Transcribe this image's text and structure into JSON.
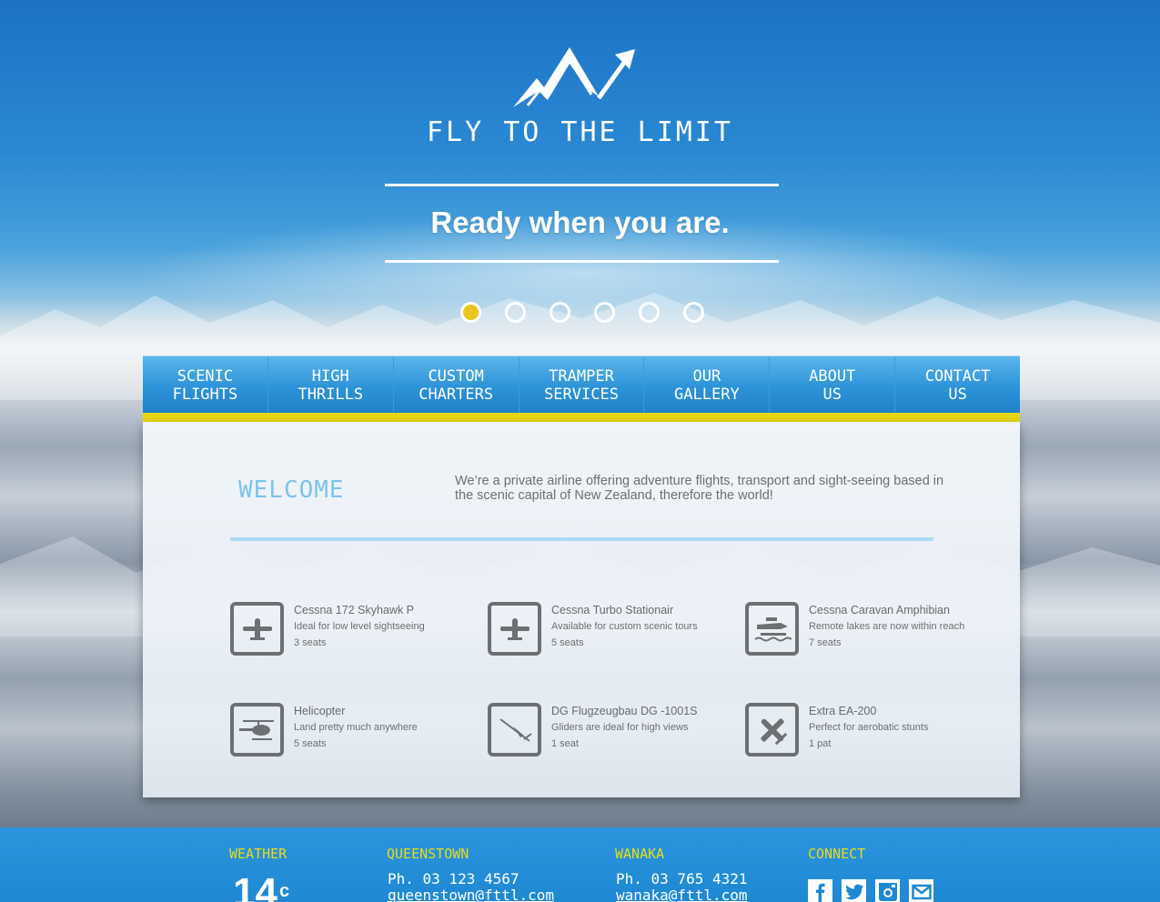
{
  "brand": {
    "name": "FLY TO THE LIMIT",
    "tagline": "Ready when you are."
  },
  "slider": {
    "slide_count": 6,
    "active_index": 0,
    "active_color": "#e9c51e"
  },
  "nav": [
    {
      "line1": "SCENIC",
      "line2": "FLIGHTS"
    },
    {
      "line1": "HIGH",
      "line2": "THRILLS"
    },
    {
      "line1": "CUSTOM",
      "line2": "CHARTERS"
    },
    {
      "line1": "TRAMPER",
      "line2": "SERVICES"
    },
    {
      "line1": "OUR",
      "line2": "GALLERY"
    },
    {
      "line1": "ABOUT",
      "line2": "US"
    },
    {
      "line1": "CONTACT",
      "line2": "US"
    }
  ],
  "welcome": {
    "title": "WELCOME",
    "text": "We’re a private airline offering adventure flights, transport and sight-seeing based in the scenic capital of New Zealand, therefore the world!"
  },
  "fleet": [
    {
      "name": "Cessna 172 Skyhawk P",
      "desc": "Ideal for low level sightseeing",
      "seats": "3 seats",
      "icon": "plane-icon"
    },
    {
      "name": "Cessna Turbo Stationair",
      "desc": "Available for custom scenic tours",
      "seats": "5 seats",
      "icon": "plane-icon"
    },
    {
      "name": "Cessna Caravan Amphibian",
      "desc": "Remote lakes are now within reach",
      "seats": "7 seats",
      "icon": "seaplane-icon"
    },
    {
      "name": "Helicopter",
      "desc": "Land pretty much anywhere",
      "seats": "5 seats",
      "icon": "helicopter-icon"
    },
    {
      "name": "DG Flugzeugbau DG -1001S",
      "desc": "Gliders are ideal for high views",
      "seats": "1 seat",
      "icon": "glider-icon"
    },
    {
      "name": "Extra EA-200",
      "desc": "Perfect for aerobatic stunts",
      "seats": "1 pat",
      "icon": "aerobatic-plane-icon"
    }
  ],
  "footer": {
    "weather": {
      "heading": "WEATHER",
      "temp": "14",
      "unit": "c"
    },
    "queenstown": {
      "heading": "QUEENSTOWN",
      "phone": "Ph. 03 123 4567",
      "email": "queenstown@fttl.com"
    },
    "wanaka": {
      "heading": "WANAKA",
      "phone": "Ph. 03 765 4321",
      "email": "wanaka@fttl.com"
    },
    "connect": {
      "heading": "CONNECT",
      "icons": [
        "facebook-icon",
        "twitter-icon",
        "instagram-icon",
        "mail-icon"
      ]
    }
  },
  "colors": {
    "accent_yellow": "#e6d717",
    "nav_blue": "#2d93d8",
    "footer_blue": "#2090d8",
    "welcome_blue": "#7cc3ec"
  }
}
